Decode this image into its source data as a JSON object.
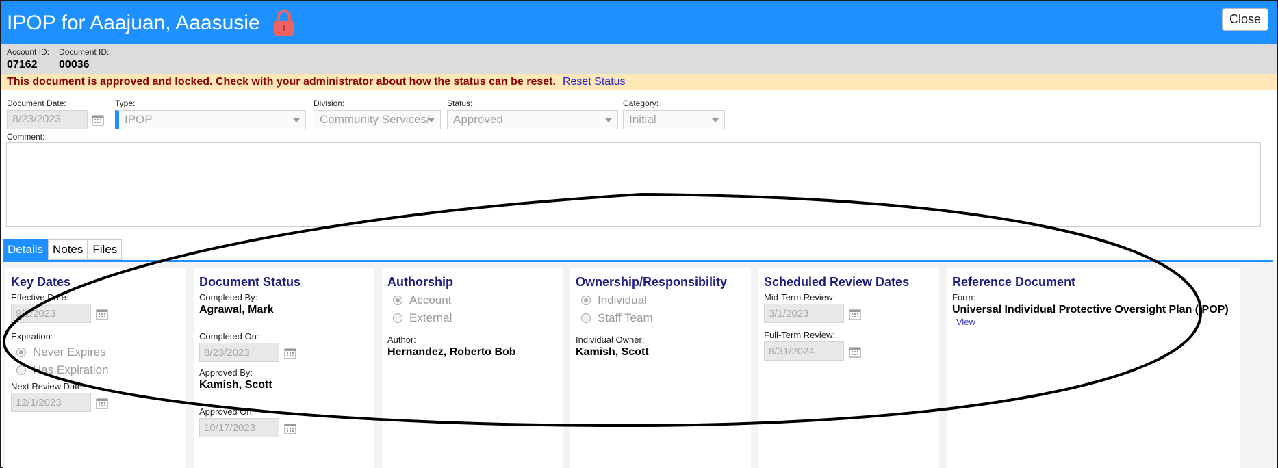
{
  "header": {
    "title": "IPOP for Aaajuan, Aaasusie",
    "close_label": "Close",
    "brand_color": "#1e90ff",
    "lock_icon": "lock-icon"
  },
  "ids": {
    "account_label": "Account ID:",
    "account_value": "07162",
    "document_label": "Document ID:",
    "document_value": "00036"
  },
  "warning": {
    "message": "This document is approved and locked. Check with your administrator about how the status can be reset.",
    "reset_label": "Reset Status"
  },
  "form": {
    "document_date_label": "Document Date:",
    "document_date_value": "8/23/2023",
    "type_label": "Type:",
    "type_value": "IPOP",
    "division_label": "Division:",
    "division_value": "Community Services/",
    "status_label": "Status:",
    "status_value": "Approved",
    "category_label": "Category:",
    "category_value": "Initial",
    "comment_label": "Comment:"
  },
  "tabs": [
    {
      "label": "Details",
      "active": true
    },
    {
      "label": "Notes",
      "active": false
    },
    {
      "label": "Files",
      "active": false
    }
  ],
  "key_dates": {
    "title": "Key Dates",
    "effective_label": "Effective Date:",
    "effective_value": "9/1/2023",
    "expiration_label": "Expiration:",
    "never_expires": "Never Expires",
    "has_expiration": "Has Expiration",
    "next_review_label": "Next Review Date:",
    "next_review_value": "12/1/2023"
  },
  "document_status": {
    "title": "Document Status",
    "completed_by_label": "Completed By:",
    "completed_by_value": "Agrawal, Mark",
    "completed_on_label": "Completed On:",
    "completed_on_value": "8/23/2023",
    "approved_by_label": "Approved By:",
    "approved_by_value": "Kamish, Scott",
    "approved_on_label": "Approved On:",
    "approved_on_value": "10/17/2023"
  },
  "authorship": {
    "title": "Authorship",
    "opt_account": "Account",
    "opt_external": "External",
    "author_label": "Author:",
    "author_value": "Hernandez, Roberto Bob"
  },
  "ownership": {
    "title": "Ownership/Responsibility",
    "opt_individual": "Individual",
    "opt_staff_team": "Staff Team",
    "owner_label": "Individual Owner:",
    "owner_value": "Kamish, Scott"
  },
  "review_dates": {
    "title": "Scheduled Review Dates",
    "mid_label": "Mid-Term Review:",
    "mid_value": "3/1/2023",
    "full_label": "Full-Term Review:",
    "full_value": "8/31/2024"
  },
  "reference": {
    "title": "Reference Document",
    "form_label": "Form:",
    "form_value": "Universal Individual Protective Oversight Plan (IPOP)",
    "view_label": "View"
  }
}
